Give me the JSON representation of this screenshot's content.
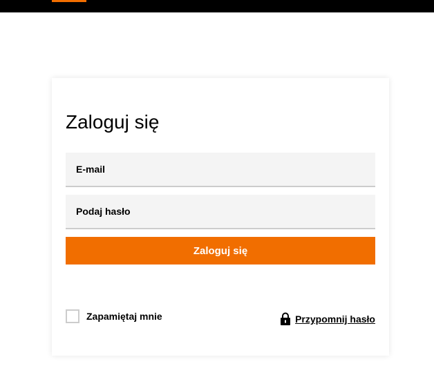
{
  "login": {
    "title": "Zaloguj się",
    "email_placeholder": "E-mail",
    "password_placeholder": "Podaj hasło",
    "submit_label": "Zaloguj się",
    "remember_label": "Zapamiętaj mnie",
    "remember_checked": false,
    "forgot_label": "Przypomnij hasło"
  },
  "icons": {
    "forgot": "lock-icon"
  },
  "colors": {
    "accent": "#f16e00",
    "header": "#000000",
    "field_bg": "#f4f4f4"
  }
}
